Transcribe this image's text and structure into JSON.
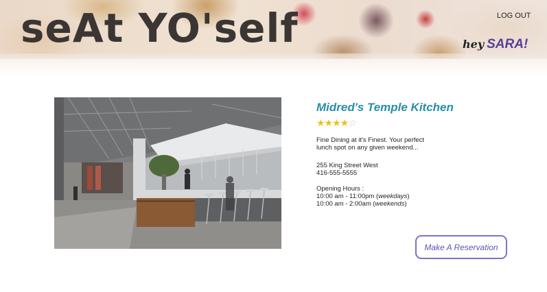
{
  "header": {
    "logo": "seAt YO'self",
    "logout_label": "LOG OUT",
    "greeting_prefix": "hey",
    "username": "SARA!"
  },
  "restaurant": {
    "name": "Midred's Temple Kitchen",
    "rating": {
      "filled": "★★★★",
      "empty": "☆",
      "value": 4,
      "max": 5
    },
    "description": "Fine Dining at it's Finest.  Your perfect lunch spot on any given weekend...",
    "address_line": "255 King Street West",
    "phone": "416-555-5555",
    "hours_title": "Opening Hours :",
    "hours_weekdays_time": "10:00 am - 11:00pm (",
    "hours_weekdays_label": "weekdays",
    "hours_weekends_time": "10:00 am -  2:00am (",
    "hours_weekends_label": "weekends",
    "close_paren": ")"
  },
  "actions": {
    "reserve_label": "Make A Reservation"
  },
  "colors": {
    "accent_name": "#2a8ea8",
    "username": "#5a3e98",
    "button_border": "#7a73c6",
    "star": "#e9c21a"
  }
}
